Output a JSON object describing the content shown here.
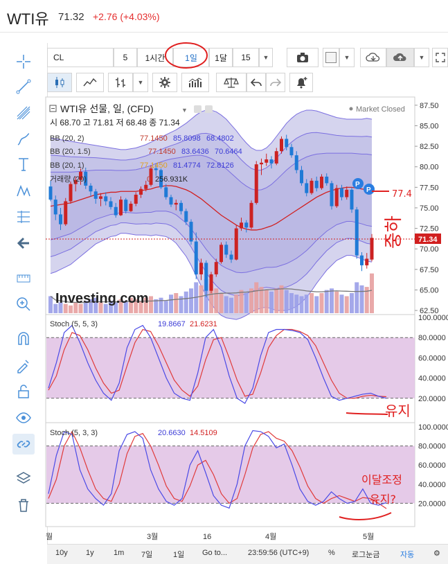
{
  "header": {
    "title": "WTI유",
    "price": "71.32",
    "change": "+2.76 (+4.03%)"
  },
  "toolbar": {
    "symbol": "CL",
    "interval_num": "5",
    "interval_hour": "1시간",
    "interval_day": "1일",
    "interval_month": "1달",
    "interval_custom": "15"
  },
  "chart_info": {
    "title": "WTI유 선물, 일, (CFD)",
    "ohlc": "시 68.70 고 71.81 저 68.48 종 71.34",
    "market_status": "Market Closed",
    "watermark": "Investing.com",
    "last_price_label": "71.34"
  },
  "legend": {
    "bb1_label": "BB (20, 2)",
    "bb1_v1": "77.1450",
    "bb1_v2": "85.8098",
    "bb1_v3": "68.4802",
    "bb2_label": "BB (20, 1.5)",
    "bb2_v1": "77.1450",
    "bb2_v2": "83.6436",
    "bb2_v3": "70.6464",
    "bb3_label": "BB (20, 1)",
    "bb3_v1": "77.1450",
    "bb3_v2": "81.4774",
    "bb3_v3": "72.8126",
    "vol_label": "거래량 (20)",
    "vol_v1": "0",
    "vol_v2": "256.931K",
    "stoch1_label": "Stoch (5, 5, 3)",
    "stoch1_k": "19.8667",
    "stoch1_d": "21.6231",
    "stoch2_label": "Stoch (5, 3, 3)",
    "stoch2_k": "20.6630",
    "stoch2_d": "14.5109"
  },
  "annotations": {
    "note1": "77.4",
    "note2": "중하",
    "note3": "유지",
    "note4": "이달조정",
    "note5": "유지?"
  },
  "bottom": {
    "range_10y": "10y",
    "range_1y": "1y",
    "range_1m": "1m",
    "range_7d": "7일",
    "range_1d": "1일",
    "goto": "Go to...",
    "clock": "23:59:56 (UTC+9)",
    "percent": "%",
    "log": "로그눈금",
    "auto": "자동"
  },
  "colors": {
    "up": "#cc2222",
    "down": "#1f7ad6",
    "bb_fill": "#c7c5e8",
    "bb_line": "#7b6fe0",
    "mid": "#d11f1f",
    "stoch_k": "#4a4ae6",
    "stoch_d": "#e03a3a",
    "stoch_bg": "#e2c4e6"
  },
  "chart_data": [
    {
      "type": "candlestick",
      "title": "WTI유 선물, 일, (CFD)",
      "y_ticks": [
        62.5,
        65,
        67.5,
        70,
        72.5,
        75,
        77.5,
        80,
        82.5,
        85,
        87.5
      ],
      "x_ticks": [
        "월",
        "3월",
        "16",
        "4월",
        "5월"
      ],
      "ylim": [
        62,
        88.5
      ],
      "candles": [
        [
          77.6,
          78.3,
          75.8,
          76.0
        ],
        [
          76.0,
          76.5,
          73.5,
          74.2
        ],
        [
          74.2,
          75.0,
          72.3,
          73.0
        ],
        [
          73.0,
          76.2,
          72.8,
          75.8
        ],
        [
          75.8,
          78.2,
          75.5,
          77.9
        ],
        [
          77.9,
          78.8,
          77.0,
          78.4
        ],
        [
          78.4,
          79.8,
          77.8,
          79.4
        ],
        [
          79.4,
          79.9,
          77.3,
          77.7
        ],
        [
          77.7,
          78.0,
          76.4,
          77.0
        ],
        [
          77.0,
          77.3,
          75.5,
          76.1
        ],
        [
          76.1,
          76.8,
          75.2,
          76.4
        ],
        [
          76.4,
          76.9,
          75.3,
          75.8
        ],
        [
          75.8,
          76.3,
          74.8,
          75.1
        ],
        [
          75.1,
          75.6,
          73.8,
          74.1
        ],
        [
          74.1,
          76.4,
          74.0,
          76.0
        ],
        [
          76.0,
          76.2,
          74.3,
          74.6
        ],
        [
          74.6,
          75.8,
          74.5,
          75.5
        ],
        [
          75.5,
          76.9,
          75.2,
          76.6
        ],
        [
          76.6,
          77.6,
          76.2,
          77.3
        ],
        [
          77.3,
          78.3,
          77.0,
          77.8
        ],
        [
          77.8,
          80.2,
          77.6,
          79.8
        ],
        [
          79.8,
          80.4,
          78.9,
          79.6
        ],
        [
          79.6,
          79.8,
          77.3,
          77.5
        ],
        [
          77.5,
          77.9,
          76.0,
          76.3
        ],
        [
          76.3,
          76.6,
          75.1,
          75.4
        ],
        [
          75.4,
          76.0,
          74.7,
          75.6
        ],
        [
          75.6,
          75.9,
          74.2,
          74.6
        ],
        [
          74.6,
          74.9,
          72.9,
          73.3
        ],
        [
          73.3,
          73.6,
          70.5,
          70.9
        ],
        [
          70.9,
          72.0,
          66.3,
          66.9
        ],
        [
          66.9,
          68.8,
          66.2,
          68.3
        ],
        [
          68.3,
          68.6,
          64.1,
          64.9
        ],
        [
          64.9,
          67.2,
          64.6,
          66.9
        ],
        [
          66.9,
          68.8,
          66.6,
          68.4
        ],
        [
          68.4,
          70.8,
          68.2,
          70.5
        ],
        [
          70.5,
          70.9,
          68.9,
          69.3
        ],
        [
          69.3,
          69.8,
          68.3,
          68.7
        ],
        [
          68.7,
          72.9,
          68.6,
          72.5
        ],
        [
          72.5,
          73.8,
          72.2,
          73.2
        ],
        [
          73.2,
          73.5,
          72.0,
          72.6
        ],
        [
          72.6,
          75.9,
          72.4,
          75.6
        ],
        [
          75.6,
          80.7,
          75.4,
          80.3
        ],
        [
          80.3,
          81.0,
          79.0,
          80.5
        ],
        [
          80.5,
          81.6,
          80.1,
          80.9
        ],
        [
          80.9,
          81.3,
          79.8,
          80.4
        ],
        [
          80.4,
          82.3,
          80.2,
          81.9
        ],
        [
          81.9,
          83.7,
          81.6,
          83.4
        ],
        [
          83.4,
          83.9,
          82.0,
          82.4
        ],
        [
          82.4,
          82.8,
          81.1,
          81.4
        ],
        [
          81.4,
          81.9,
          79.2,
          79.6
        ],
        [
          79.6,
          80.1,
          77.7,
          78.0
        ],
        [
          78.0,
          78.5,
          76.4,
          76.8
        ],
        [
          76.8,
          78.6,
          76.6,
          78.3
        ],
        [
          78.3,
          78.8,
          77.0,
          77.4
        ],
        [
          77.4,
          79.1,
          77.2,
          78.8
        ],
        [
          78.8,
          79.2,
          77.7,
          78.0
        ],
        [
          78.0,
          78.3,
          74.8,
          75.2
        ],
        [
          75.2,
          77.8,
          75.0,
          77.4
        ],
        [
          77.4,
          77.8,
          75.9,
          76.3
        ],
        [
          76.3,
          77.6,
          76.0,
          77.2
        ],
        [
          77.2,
          77.5,
          74.4,
          74.8
        ],
        [
          74.8,
          75.1,
          68.8,
          69.2
        ],
        [
          69.2,
          69.6,
          67.3,
          68.0
        ],
        [
          68.0,
          69.5,
          67.6,
          68.8
        ],
        [
          68.7,
          71.81,
          68.48,
          71.34
        ]
      ],
      "bb_mid": [
        75.2,
        75.3,
        75.4,
        75.5,
        75.6,
        75.8,
        76.0,
        76.2,
        76.4,
        76.6,
        76.7,
        76.8,
        76.9,
        76.9,
        77.0,
        77.0,
        77.0,
        77.0,
        77.1,
        77.2,
        77.3,
        77.5,
        77.6,
        77.7,
        77.7,
        77.6,
        77.4,
        77.2,
        76.9,
        76.5,
        76.1,
        75.6,
        75.1,
        74.6,
        74.1,
        73.7,
        73.3,
        72.9,
        72.6,
        72.4,
        72.3,
        72.3,
        72.4,
        72.6,
        72.8,
        73.1,
        73.5,
        73.9,
        74.3,
        74.7,
        75.1,
        75.5,
        75.9,
        76.3,
        76.6,
        76.9,
        77.1,
        77.3,
        77.4,
        77.5,
        77.5,
        77.4,
        77.3,
        77.2,
        77.1
      ],
      "bb2_upper": [
        83.5,
        83.4,
        83.3,
        83.2,
        83.1,
        83.0,
        82.9,
        82.8,
        82.7,
        82.6,
        82.5,
        82.4,
        82.3,
        82.2,
        82.1,
        82.1,
        82.2,
        82.3,
        82.5,
        82.7,
        83.0,
        83.3,
        83.6,
        83.9,
        84.2,
        84.5,
        84.9,
        85.3,
        85.8,
        86.3,
        86.7,
        86.9,
        86.9,
        86.7,
        86.3,
        85.8,
        85.1,
        84.4,
        83.6,
        82.9,
        82.3,
        82.0,
        82.0,
        82.3,
        82.9,
        83.7,
        84.5,
        85.3,
        85.9,
        86.4,
        86.7,
        86.9,
        86.9,
        86.8,
        86.6,
        86.4,
        86.2,
        86.0,
        85.9,
        85.8,
        85.8,
        85.8,
        85.8,
        85.9,
        85.8
      ],
      "bb2_lower": [
        67.0,
        67.2,
        67.5,
        67.8,
        68.1,
        68.6,
        69.1,
        69.6,
        70.1,
        70.6,
        70.9,
        71.2,
        71.5,
        71.6,
        71.9,
        71.9,
        71.8,
        71.7,
        71.7,
        71.7,
        71.6,
        71.7,
        71.6,
        71.5,
        71.2,
        70.7,
        69.9,
        69.1,
        68.0,
        66.7,
        65.5,
        64.3,
        63.3,
        62.5,
        61.9,
        61.6,
        61.5,
        61.4,
        61.6,
        61.9,
        62.3,
        62.6,
        62.8,
        62.9,
        62.7,
        62.5,
        62.5,
        62.5,
        62.7,
        63.0,
        63.5,
        64.1,
        64.9,
        65.8,
        66.6,
        67.4,
        68.0,
        68.6,
        68.9,
        69.2,
        69.2,
        69.0,
        68.8,
        68.5,
        68.4
      ],
      "volume_k": [
        110,
        60,
        70,
        60,
        50,
        70,
        60,
        80,
        90,
        100,
        70,
        60,
        80,
        70,
        90,
        80,
        100,
        90,
        80,
        100,
        110,
        90,
        100,
        80,
        120,
        130,
        110,
        140,
        160,
        200,
        180,
        220,
        190,
        160,
        130,
        110,
        100,
        120,
        150,
        130,
        160,
        200,
        170,
        150,
        140,
        160,
        180,
        150,
        130,
        120,
        110,
        120,
        130,
        110,
        130,
        150,
        160,
        140,
        120,
        110,
        130,
        200,
        180,
        170,
        257
      ],
      "stoch1_k": [
        30,
        55,
        85,
        92,
        75,
        55,
        38,
        25,
        18,
        35,
        70,
        88,
        92,
        80,
        60,
        40,
        25,
        20,
        18,
        45,
        80,
        88,
        70,
        42,
        20,
        15,
        30,
        62,
        85,
        88,
        88,
        87,
        85,
        78,
        60,
        40,
        22,
        18,
        20,
        22,
        24,
        25,
        22,
        20
      ],
      "stoch1_d": [
        28,
        42,
        68,
        85,
        82,
        68,
        50,
        35,
        25,
        28,
        52,
        75,
        88,
        86,
        72,
        55,
        38,
        28,
        22,
        32,
        58,
        78,
        80,
        60,
        38,
        22,
        24,
        45,
        70,
        82,
        88,
        88,
        86,
        82,
        72,
        55,
        38,
        25,
        20,
        20,
        22,
        23,
        22,
        21.6
      ],
      "stoch2_k": [
        30,
        70,
        95,
        92,
        55,
        35,
        25,
        18,
        30,
        75,
        92,
        95,
        88,
        55,
        35,
        22,
        18,
        25,
        60,
        75,
        52,
        28,
        18,
        15,
        40,
        80,
        96,
        95,
        90,
        78,
        82,
        60,
        35,
        22,
        18,
        22,
        32,
        25,
        20,
        22,
        35,
        20,
        18,
        20.7
      ],
      "stoch2_d": [
        25,
        45,
        80,
        95,
        78,
        55,
        35,
        25,
        22,
        40,
        72,
        90,
        93,
        80,
        60,
        38,
        25,
        22,
        38,
        60,
        65,
        50,
        30,
        20,
        25,
        50,
        78,
        92,
        95,
        88,
        85,
        75,
        58,
        38,
        25,
        20,
        25,
        28,
        25,
        22,
        26,
        25,
        20,
        14.5
      ]
    }
  ]
}
